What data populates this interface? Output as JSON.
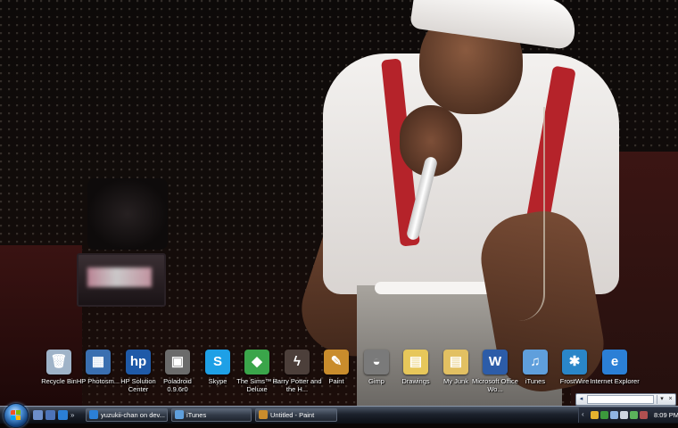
{
  "desktop": {
    "icons": [
      {
        "label": "Recycle Bin",
        "icon": "recycle-bin-icon",
        "color": "#9fb3c8",
        "glyph": "🗑"
      },
      {
        "label": "HP Photosm...",
        "icon": "hp-photosmart-icon",
        "color": "#3a6fb0",
        "glyph": "▦"
      },
      {
        "label": "HP Solution Center",
        "icon": "hp-solution-center-icon",
        "color": "#1f5aa8",
        "glyph": "hp"
      },
      {
        "label": "Poladroid 0.9.6r0",
        "icon": "poladroid-icon",
        "color": "#6b6b6b",
        "glyph": "▣"
      },
      {
        "label": "Skype",
        "icon": "skype-icon",
        "color": "#1ea0e6",
        "glyph": "S"
      },
      {
        "label": "The Sims™ 2 Deluxe",
        "icon": "sims-2-icon",
        "color": "#3aa54a",
        "glyph": "◆"
      },
      {
        "label": "Harry Potter and the H...",
        "icon": "harry-potter-icon",
        "color": "#4c3f3a",
        "glyph": "ϟ"
      },
      {
        "label": "Paint",
        "icon": "paint-icon",
        "color": "#c98c2c",
        "glyph": "✎"
      },
      {
        "label": "Gimp",
        "icon": "gimp-icon",
        "color": "#7a7a7a",
        "glyph": "◒"
      },
      {
        "label": "Drawings",
        "icon": "folder-icon",
        "color": "#e7c75a",
        "glyph": "▤"
      },
      {
        "label": "My Junk",
        "icon": "folder-icon",
        "color": "#e2c062",
        "glyph": "▤"
      },
      {
        "label": "Microsoft Office Wo...",
        "icon": "word-icon",
        "color": "#2c5ca8",
        "glyph": "W"
      },
      {
        "label": "iTunes",
        "icon": "itunes-icon",
        "color": "#5f9fdc",
        "glyph": "♫"
      },
      {
        "label": "FrostWire",
        "icon": "frostwire-icon",
        "color": "#2a86c8",
        "glyph": "✱"
      },
      {
        "label": "Internet Explorer",
        "icon": "internet-explorer-icon",
        "color": "#2b7fd6",
        "glyph": "e"
      }
    ]
  },
  "taskbar": {
    "quicklaunch": [
      {
        "icon": "show-desktop-icon",
        "color": "#6d8fc9"
      },
      {
        "icon": "switch-windows-icon",
        "color": "#4d74b8"
      },
      {
        "icon": "internet-explorer-icon",
        "color": "#2b7fd6"
      }
    ],
    "quicklaunch_more": "»",
    "tasks": [
      {
        "label": "yuzukii-chan on dev...",
        "icon": "internet-explorer-icon",
        "color": "#2b7fd6"
      },
      {
        "label": "iTunes",
        "icon": "itunes-icon",
        "color": "#5f9fdc"
      },
      {
        "label": "Untitled - Paint",
        "icon": "paint-icon",
        "color": "#c98c2c"
      }
    ],
    "tray": {
      "expand": "‹",
      "icons": [
        {
          "icon": "chrome-icon",
          "color": "#e6b22e"
        },
        {
          "icon": "security-icon",
          "color": "#3c9a3c"
        },
        {
          "icon": "network-icon",
          "color": "#8fb4e2"
        },
        {
          "icon": "volume-icon",
          "color": "#cfd6e0"
        },
        {
          "icon": "power-icon",
          "color": "#5bb35b"
        },
        {
          "icon": "app-icon",
          "color": "#b05050"
        }
      ],
      "clock": "8:09 PM"
    }
  },
  "floating_bar": {
    "left_button": "◂",
    "dropdown": "▾",
    "close": "×",
    "value": ""
  }
}
